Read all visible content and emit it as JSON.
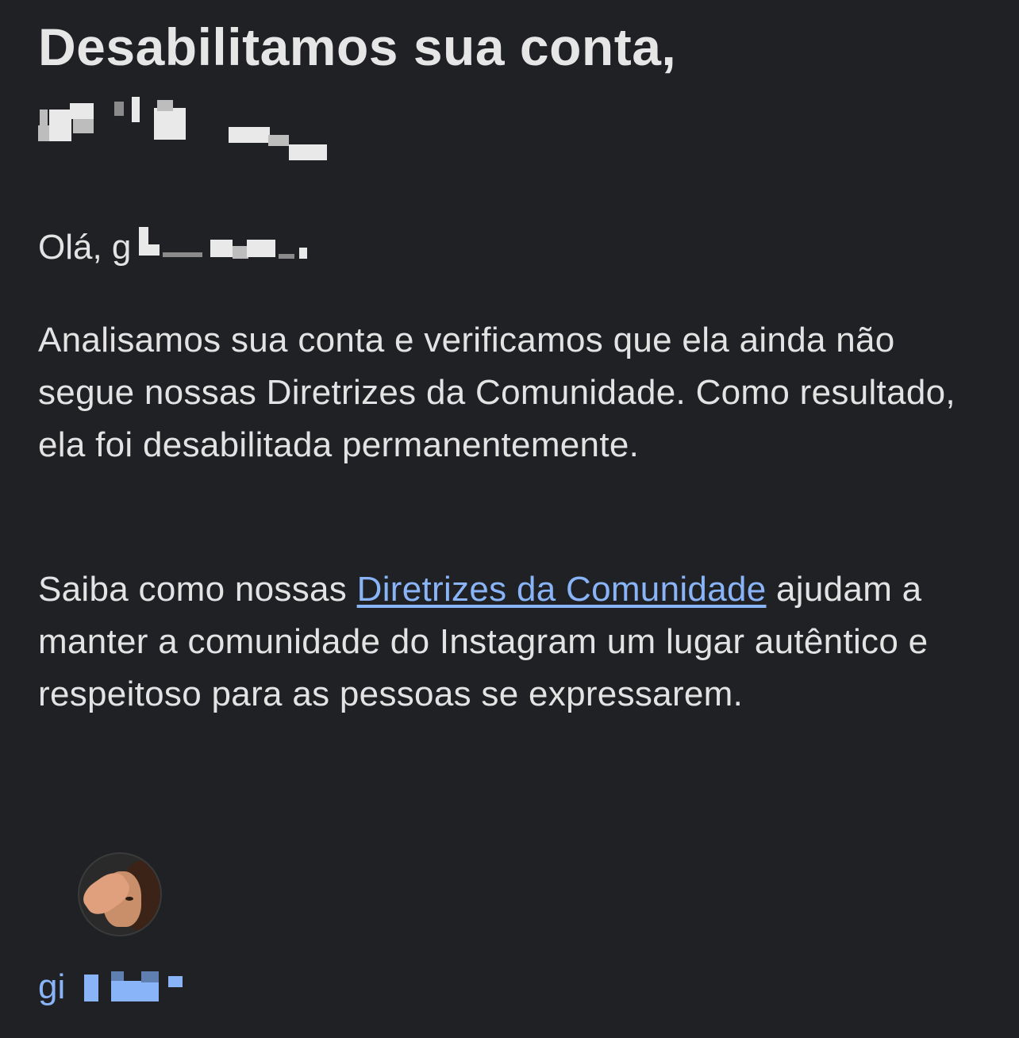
{
  "email": {
    "title": "Desabilitamos sua conta,",
    "greeting_prefix": "Olá, g",
    "paragraph_1": "Analisamos sua conta e verificamos que ela ainda não segue nossas Diretrizes da Comunidade. Como resultado, ela foi desabilitada permanentemente.",
    "paragraph_2_before_link": "Saiba como nossas ",
    "paragraph_2_link": "Diretrizes da Comunidade",
    "paragraph_2_after_link": " ajudam a manter a comunidade do Instagram um lugar autêntico e respeitoso para as pessoas se expressarem.",
    "username_prefix": "gi"
  },
  "colors": {
    "background": "#202125",
    "text": "#e3e3e3",
    "link": "#8ab4f8"
  }
}
